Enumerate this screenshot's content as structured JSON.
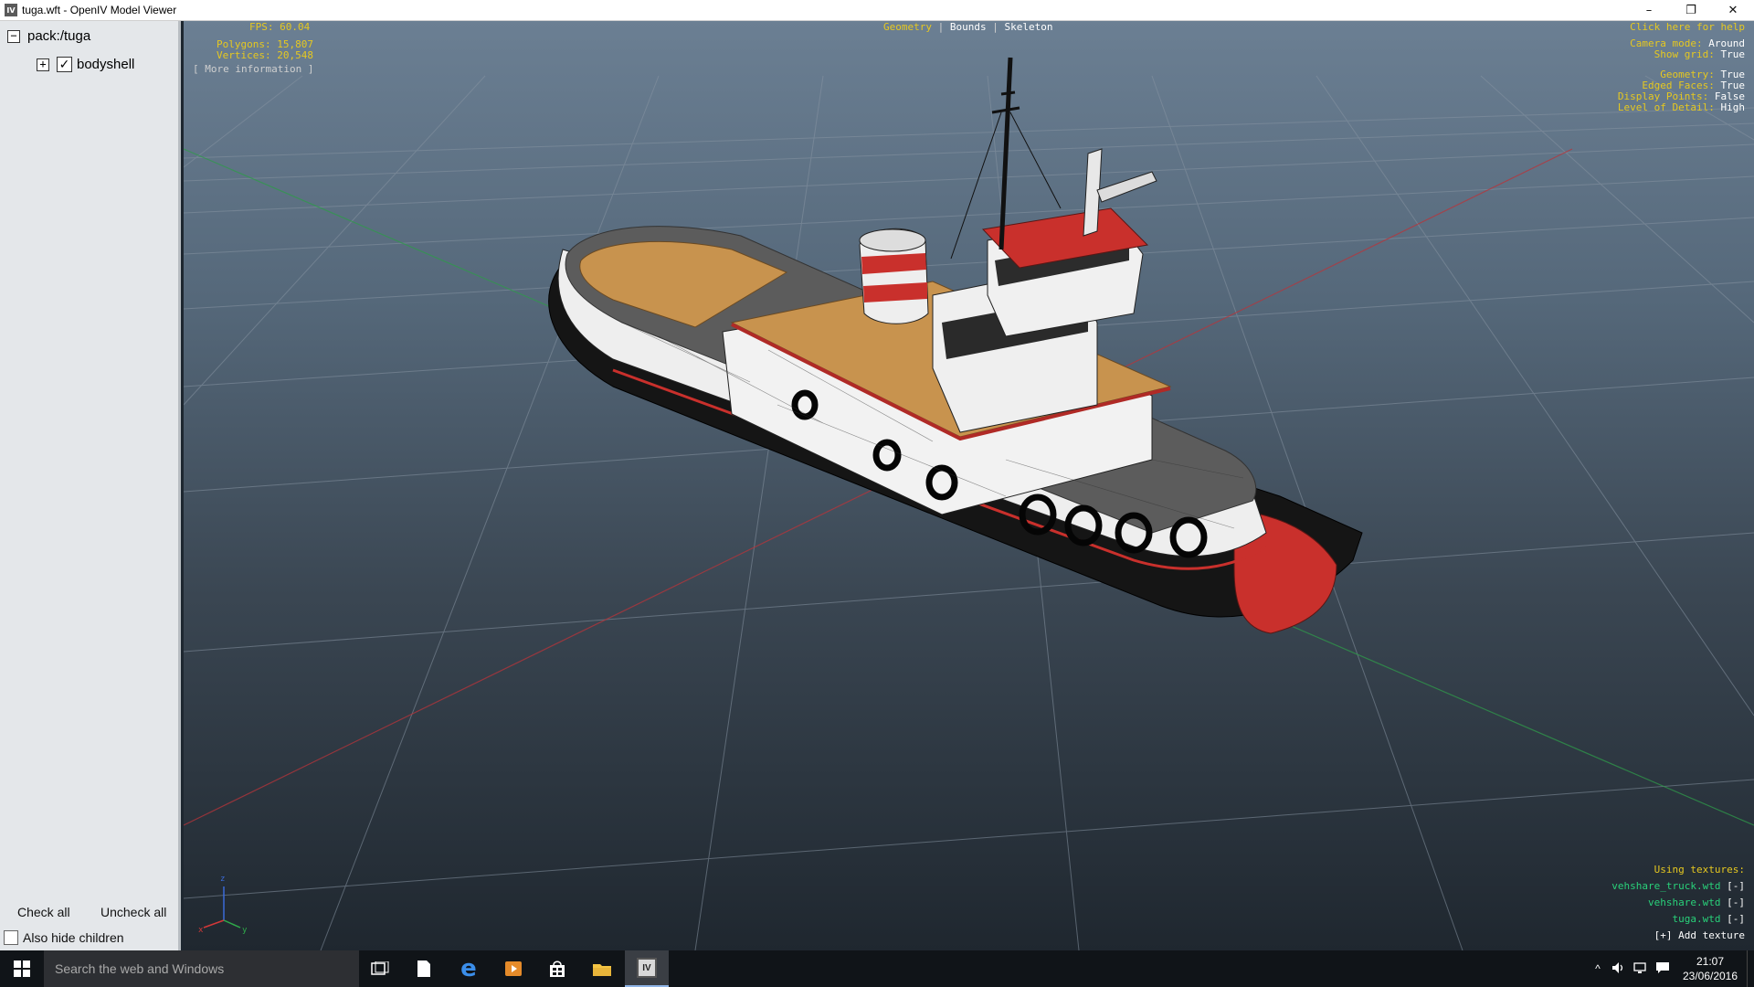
{
  "window": {
    "app_icon_text": "IV",
    "title": "tuga.wft - OpenIV Model Viewer",
    "minimize": "–",
    "restore": "❐",
    "close": "✕"
  },
  "tree": {
    "root": {
      "expander": "−",
      "label": "pack:/tuga"
    },
    "child": {
      "expander": "+",
      "checked": true,
      "check_glyph": "✓",
      "label": "bodyshell"
    }
  },
  "left_panel": {
    "check_all": "Check all",
    "uncheck_all": "Uncheck all",
    "also_hide_children": "Also hide children"
  },
  "hud": {
    "fps": "FPS: 60.04",
    "polygons": "Polygons: 15,807",
    "vertices": "Vertices: 20,548",
    "more_info": "[ More information ]",
    "view_modes": [
      "Geometry",
      "Bounds",
      "Skeleton"
    ],
    "view_sep": "|",
    "help": "Click here for help",
    "settings": [
      {
        "label": "Camera mode:",
        "value": "Around"
      },
      {
        "label": "Show grid:",
        "value": "True"
      },
      {
        "label": "Geometry:",
        "value": "True"
      },
      {
        "label": "Edged Faces:",
        "value": "True"
      },
      {
        "label": "Display Points:",
        "value": "False"
      },
      {
        "label": "Level of Detail:",
        "value": "High"
      }
    ],
    "textures_title": "Using textures:",
    "textures": [
      {
        "name": "vehshare_truck.wtd",
        "action": "[-]"
      },
      {
        "name": "vehshare.wtd",
        "action": "[-]"
      },
      {
        "name": "tuga.wtd",
        "action": "[-]"
      }
    ],
    "add_texture": "[+] Add texture",
    "axis": {
      "z": "z",
      "x": "x",
      "y": "y"
    }
  },
  "taskbar": {
    "search_placeholder": "Search the web and Windows",
    "time": "21:07",
    "date": "23/06/2016",
    "tray_up": "^"
  },
  "colors": {
    "hud_yellow": "#e6c820",
    "hud_green": "#29d17a",
    "hull_red": "#c9302c",
    "deck_wood": "#c8934e"
  }
}
